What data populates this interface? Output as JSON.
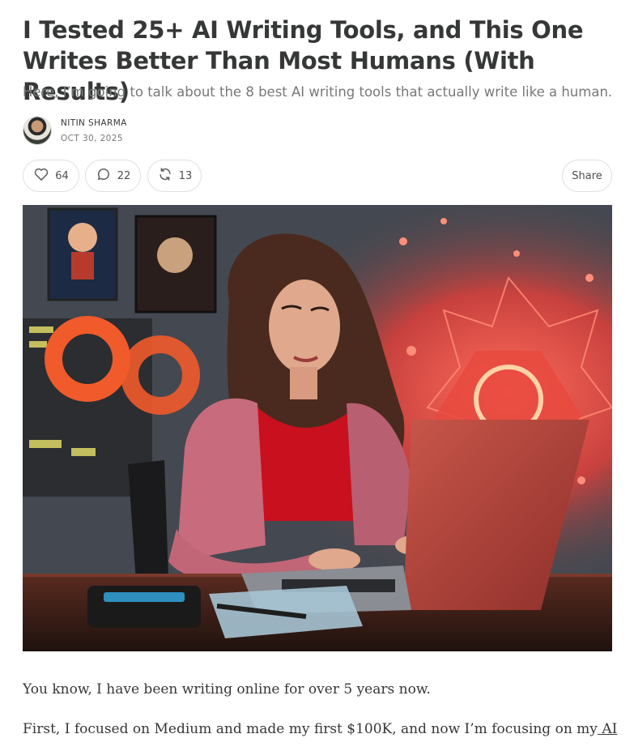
{
  "post": {
    "title": "I Tested 25+ AI Writing Tools, and This One Writes Better Than Most Humans (With Results)",
    "subtitle": "Here, I’m going to talk about the 8 best AI writing tools that actually write like a human.",
    "author": "NITIN SHARMA",
    "date": "OCT 30, 2025"
  },
  "actions": {
    "likes": "64",
    "comments": "22",
    "restacks": "13",
    "share_label": "Share",
    "icons": {
      "like": "heart-icon",
      "comment": "comment-bubble-icon",
      "restack": "restack-icon"
    }
  },
  "hero": {
    "description_icon": "hero-illustration"
  },
  "body": {
    "p1": "You know, I have been writing online for over 5 years now.",
    "p2_text": "First, I focused on Medium and made my first $100K, and now I’m focusing on my",
    "p2_link": " AI"
  },
  "colors": {
    "text": "#363737",
    "muted": "#77787a",
    "border": "#e0e0e0"
  }
}
